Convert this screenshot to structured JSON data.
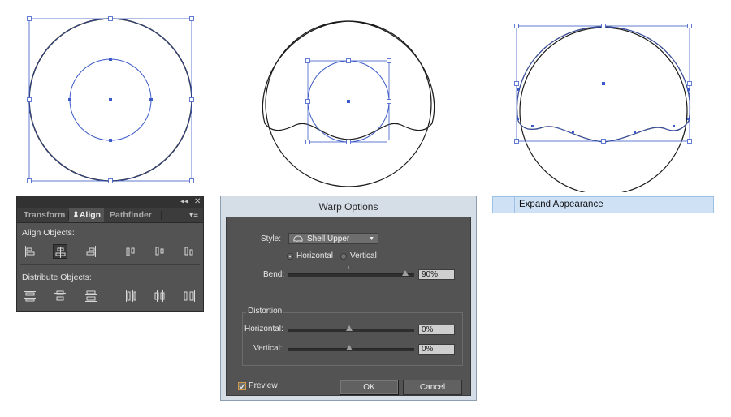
{
  "align_panel": {
    "collapse_glyph": "◂◂",
    "close_glyph": "✕",
    "tabs": [
      {
        "label": "Transform"
      },
      {
        "label": "Align",
        "icon": "up-down-arrows-icon"
      },
      {
        "label": "Pathfinder"
      }
    ],
    "panel_menu_glyph": "▾≡",
    "align_objects_label": "Align Objects:",
    "distribute_objects_label": "Distribute Objects:",
    "align_icons": [
      "horizontal-align-left-icon",
      "horizontal-align-center-icon",
      "horizontal-align-right-icon",
      "vertical-align-top-icon",
      "vertical-align-center-icon",
      "vertical-align-bottom-icon"
    ],
    "distribute_icons": [
      "vertical-distribute-top-icon",
      "vertical-distribute-center-icon",
      "vertical-distribute-bottom-icon",
      "horizontal-distribute-left-icon",
      "horizontal-distribute-center-icon",
      "horizontal-distribute-right-icon"
    ]
  },
  "warp_dialog": {
    "title": "Warp Options",
    "style_label": "Style:",
    "style_value": "Shell Upper",
    "style_icon": "shell-upper-icon",
    "orientation_horizontal": "Horizontal",
    "orientation_vertical": "Vertical",
    "orientation_selected": "Horizontal",
    "bend_label": "Bend:",
    "bend_value": "90%",
    "distortion_label": "Distortion",
    "horizontal_label": "Horizontal:",
    "horizontal_value": "0%",
    "vertical_label": "Vertical:",
    "vertical_value": "0%",
    "preview_label": "Preview",
    "preview_checked": true,
    "ok_label": "OK",
    "cancel_label": "Cancel"
  },
  "expand_appearance": {
    "label": "Expand Appearance"
  },
  "colors": {
    "selection_blue": "#3c5bc9",
    "panel_bg": "#535353",
    "dialog_titlebar": "#d5dde7",
    "menu_highlight": "#cfe1f5"
  }
}
